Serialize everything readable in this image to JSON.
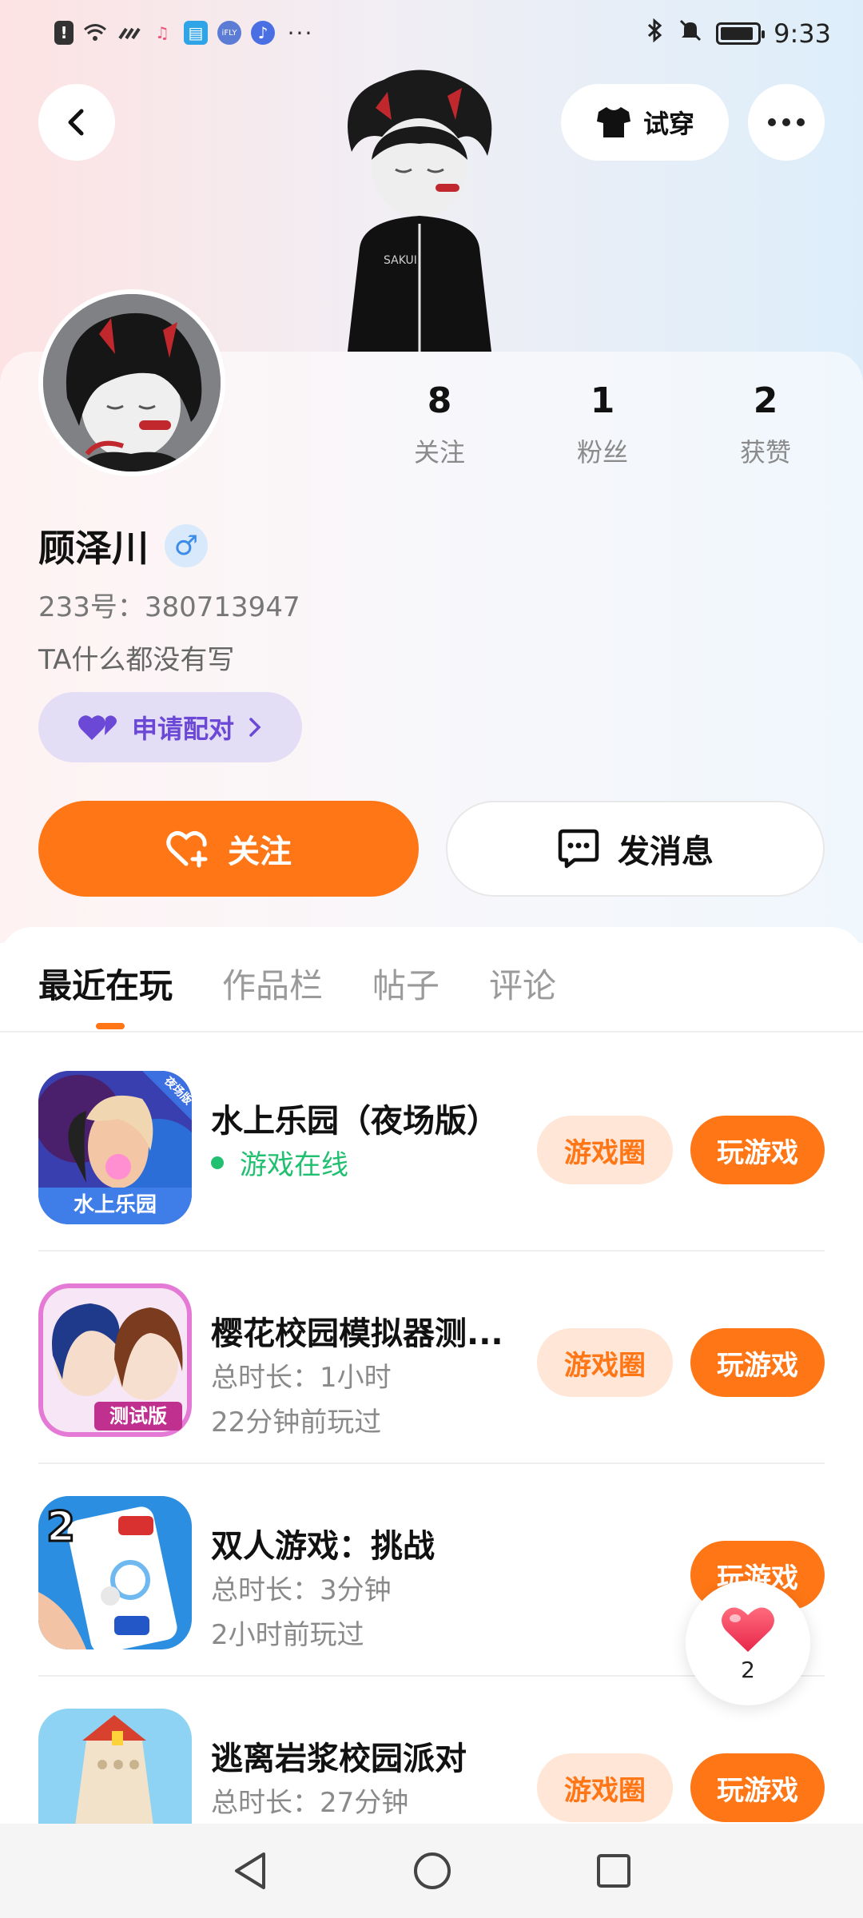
{
  "status_bar": {
    "time": "9:33",
    "left_icons": [
      "alert-icon",
      "wifi-icon",
      "signal-icon",
      "music-app-icon",
      "book-app-icon",
      "ifly-app-icon",
      "music-note-app-icon",
      "more-notifications-icon"
    ],
    "ifly_label": "iFLY",
    "more_dots": "···",
    "right_icons": [
      "bluetooth-icon",
      "mute-icon",
      "battery-icon"
    ],
    "battery_level": 0.9
  },
  "header": {
    "back_icon": "chevron-left-icon",
    "tryon_label": "试穿",
    "tryon_icon": "tshirt-icon",
    "more_icon": "more-dots-icon"
  },
  "profile": {
    "username": "顾泽川",
    "gender_symbol": "♂",
    "uid": "233号：380713947",
    "bio": "TA什么都没有写",
    "pair_label": "申请配对",
    "pair_icon": "heart-pair-icon",
    "stats": [
      {
        "value": "8",
        "label": "关注"
      },
      {
        "value": "1",
        "label": "粉丝"
      },
      {
        "value": "2",
        "label": "获赞"
      }
    ]
  },
  "actions": {
    "follow_label": "关注",
    "message_label": "发消息"
  },
  "tabs": [
    {
      "label": "最近在玩",
      "active": true
    },
    {
      "label": "作品栏",
      "active": false
    },
    {
      "label": "帖子",
      "active": false
    },
    {
      "label": "评论",
      "active": false
    }
  ],
  "games": [
    {
      "title": "水上乐园（夜场版）",
      "status": "游戏在线",
      "badge": "夜场版",
      "icon_text": "水上乐园",
      "circle_label": "游戏圈",
      "play_label": "玩游戏"
    },
    {
      "title": "樱花校园模拟器测...",
      "duration": "总时长：1小时",
      "last_played": "22分钟前玩过",
      "icon_text": "测试版",
      "circle_label": "游戏圈",
      "play_label": "玩游戏"
    },
    {
      "title": "双人游戏：挑战",
      "duration": "总时长：3分钟",
      "last_played": "2小时前玩过",
      "icon_text": "2",
      "play_label": "玩游戏"
    },
    {
      "title": "逃离岩浆校园派对",
      "duration": "总时长：27分钟",
      "circle_label": "游戏圈",
      "play_label": "玩游戏"
    }
  ],
  "floating_like": {
    "count": "2",
    "icon": "heart-icon"
  },
  "nav_bar": [
    "back-triangle-icon",
    "home-circle-icon",
    "recent-square-icon"
  ],
  "colors": {
    "accent": "#ff7616",
    "online": "#21c071",
    "pair": "#6b49d6"
  }
}
